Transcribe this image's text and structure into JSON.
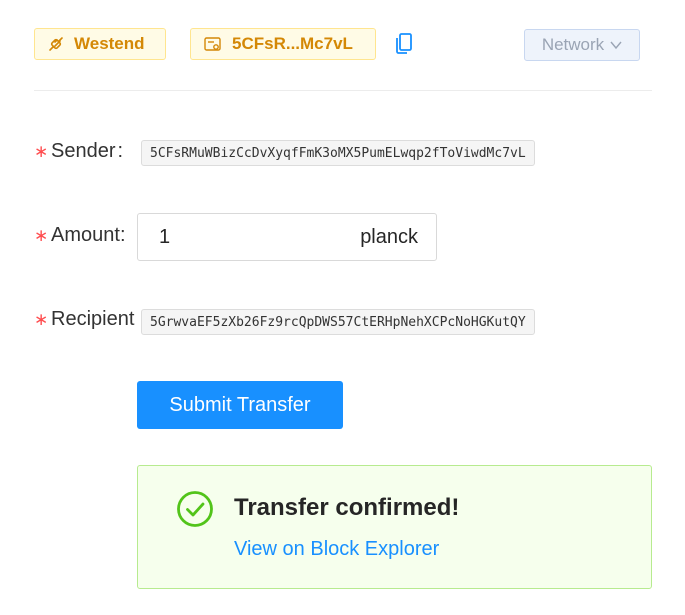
{
  "header": {
    "network_tag": "Westend",
    "account_tag": "5CFsR...Mc7vL",
    "network_select_label": "Network"
  },
  "form": {
    "sender_label": "Sender",
    "sender_value": "5CFsRMuWBizCcDvXyqfFmK3oMX5PumELwqp2fToViwdMc7vL",
    "amount_label": "Amount",
    "amount_value": "1",
    "amount_unit": "planck",
    "recipient_label": "Recipient",
    "recipient_value": "5GrwvaEF5zXb26Fz9rcQpDWS57CtERHpNehXCPcNoHGKutQY",
    "submit_label": "Submit Transfer"
  },
  "result": {
    "title": "Transfer confirmed!",
    "link_text": "View on Block Explorer"
  },
  "colors": {
    "accent": "#1890ff",
    "tag_text": "#d48806",
    "success_green": "#52c41a",
    "required_red": "#ff4d4f"
  }
}
